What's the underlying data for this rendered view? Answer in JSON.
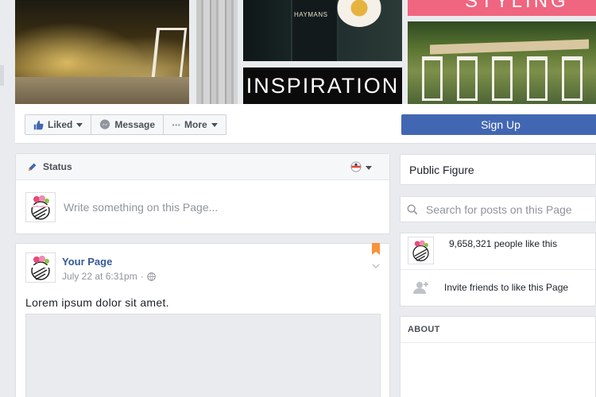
{
  "cover": {
    "inspiration_text": "INSPIRATION",
    "pink_banner_text": "STYLING",
    "bottle_label": "HAYMANS"
  },
  "actions": {
    "liked_label": "Liked",
    "message_label": "Message",
    "more_label": "More",
    "signup_label": "Sign Up"
  },
  "status": {
    "header_label": "Status",
    "composer_placeholder": "Write something on this Page..."
  },
  "post": {
    "author": "Your Page",
    "timestamp": "July 22 at 6:31pm",
    "separator": "·",
    "text": "Lorem ipsum dolor sit amet."
  },
  "sidebar": {
    "category": "Public Figure",
    "search_placeholder": "Search for posts on this Page",
    "likes_text": "9,658,321 people like this",
    "invite_text": "Invite friends to like this Page",
    "about_heading": "ABOUT"
  },
  "colors": {
    "facebook_blue": "#4267b2",
    "link_blue": "#365899",
    "page_background": "#e9ebee",
    "bookmark_orange": "#f7923b"
  },
  "icons": {
    "liked": "thumbs-up-icon",
    "message": "messenger-icon",
    "more": "ellipsis-icon",
    "status": "pencil-icon",
    "audience": "audience-selector-icon",
    "privacy": "globe-icon",
    "search": "search-icon",
    "invite": "add-friend-icon",
    "bookmark": "bookmark-icon"
  }
}
